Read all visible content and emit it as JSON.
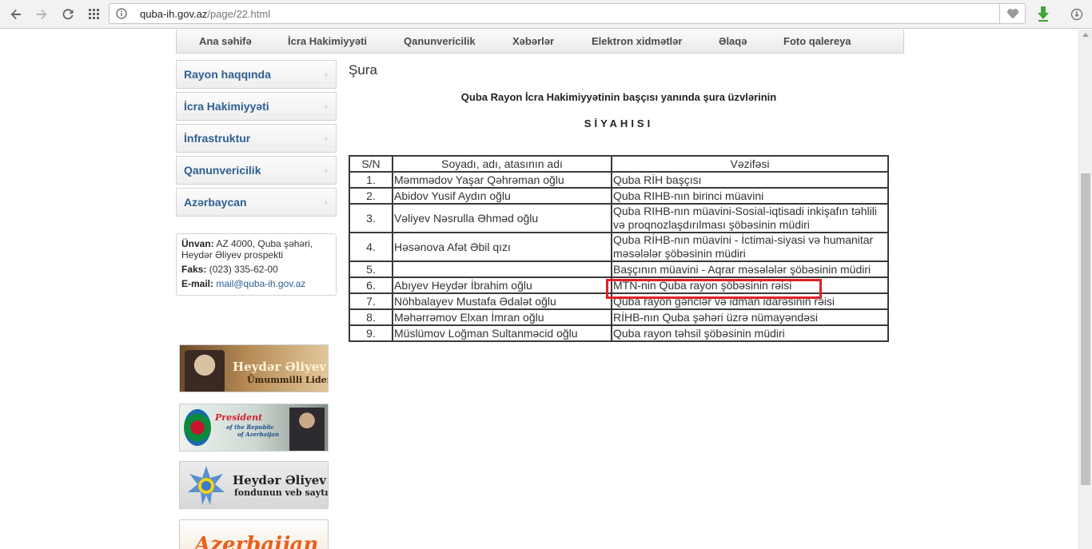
{
  "browser": {
    "url_host": "quba-ih.gov.az",
    "url_path": "/page/22.html"
  },
  "topnav": [
    "Ana səhifə",
    "İcra Hakimiyyəti",
    "Qanunvericilik",
    "Xəbərlər",
    "Elektron xidmətlər",
    "Əlaqə",
    "Foto qalereya"
  ],
  "sidebar": [
    {
      "label": "Rayon haqqında"
    },
    {
      "label": "İcra Hakimiyyəti"
    },
    {
      "label": "İnfrastruktur"
    },
    {
      "label": "Qanunvericilik"
    },
    {
      "label": "Azərbaycan"
    }
  ],
  "contact": {
    "address_label": "Ünvan:",
    "address_value": "AZ 4000, Quba şəhəri, Heydər Əliyev prospekti",
    "fax_label": "Faks:",
    "fax_value": "(023) 335-62-00",
    "email_label": "E-mail:",
    "email_value": "mail@quba-ih.gov.az"
  },
  "banners": {
    "heydar": {
      "line1": "Heydər Əliyev",
      "line2": "Ümummilli Lider"
    },
    "president": {
      "line1": "President",
      "line2": "of the Republic",
      "line3": "of Azerbaijan"
    },
    "fund": {
      "line1": "Heydər Əliyev",
      "line2": "fondunun veb saytı"
    },
    "azerbaijan": {
      "line1": "Azerbaijan"
    }
  },
  "content": {
    "title": "Şura",
    "heading1": "Quba Rayon İcra Hakimiyyətinin başçısı yanında şura üzvlərinin",
    "heading2": "SİYAHISI",
    "table_headers": [
      "S/N",
      "Soyadı, adı, atasının adı",
      "Vəzifəsi"
    ],
    "rows": [
      {
        "num": "1.",
        "name": "Məmmədov Yaşar Qəhrəman oğlu",
        "position": "Quba RİH başçısı"
      },
      {
        "num": "2.",
        "name": "Abidov Yusif Aydın oğlu",
        "position": "Quba RIHB-nın birinci müavini"
      },
      {
        "num": "3.",
        "name": "Vəliyev Nəsrulla Əhməd oğlu",
        "position": "Quba RIHB-nın müavini-Sosial-iqtisadi inkişafın təhlili və proqnozlaşdırılması şöbəsinin müdiri"
      },
      {
        "num": "4.",
        "name": "Həsənova Afət Əbil qızı",
        "position": "Quba RİHB-nın müavini - İctimai-siyasi və humanitar məsələlər şöbəsinin müdiri"
      },
      {
        "num": "5.",
        "name": "",
        "position": "Başçının müavini - Aqrar məsələlər şöbəsinin müdiri"
      },
      {
        "num": "6.",
        "name": "Abıyev Heydər İbrahim oğlu",
        "position": "MTN-nin Quba rayon şöbəsinin rəisi"
      },
      {
        "num": "7.",
        "name": "Nöhbalayev Mustafa Ədalət oğlu",
        "position": "Quba rayon gənclər və idman idarəsinin rəisi"
      },
      {
        "num": "8.",
        "name": "Məhərrəmov Elxan İmran oğlu",
        "position": "RİHB-nın Quba şəhəri üzrə nümayəndəsi"
      },
      {
        "num": "9.",
        "name": "Müslümov Loğman Sultanməcid oğlu",
        "position": "Quba rayon təhsil şöbəsinin müdiri"
      }
    ]
  }
}
